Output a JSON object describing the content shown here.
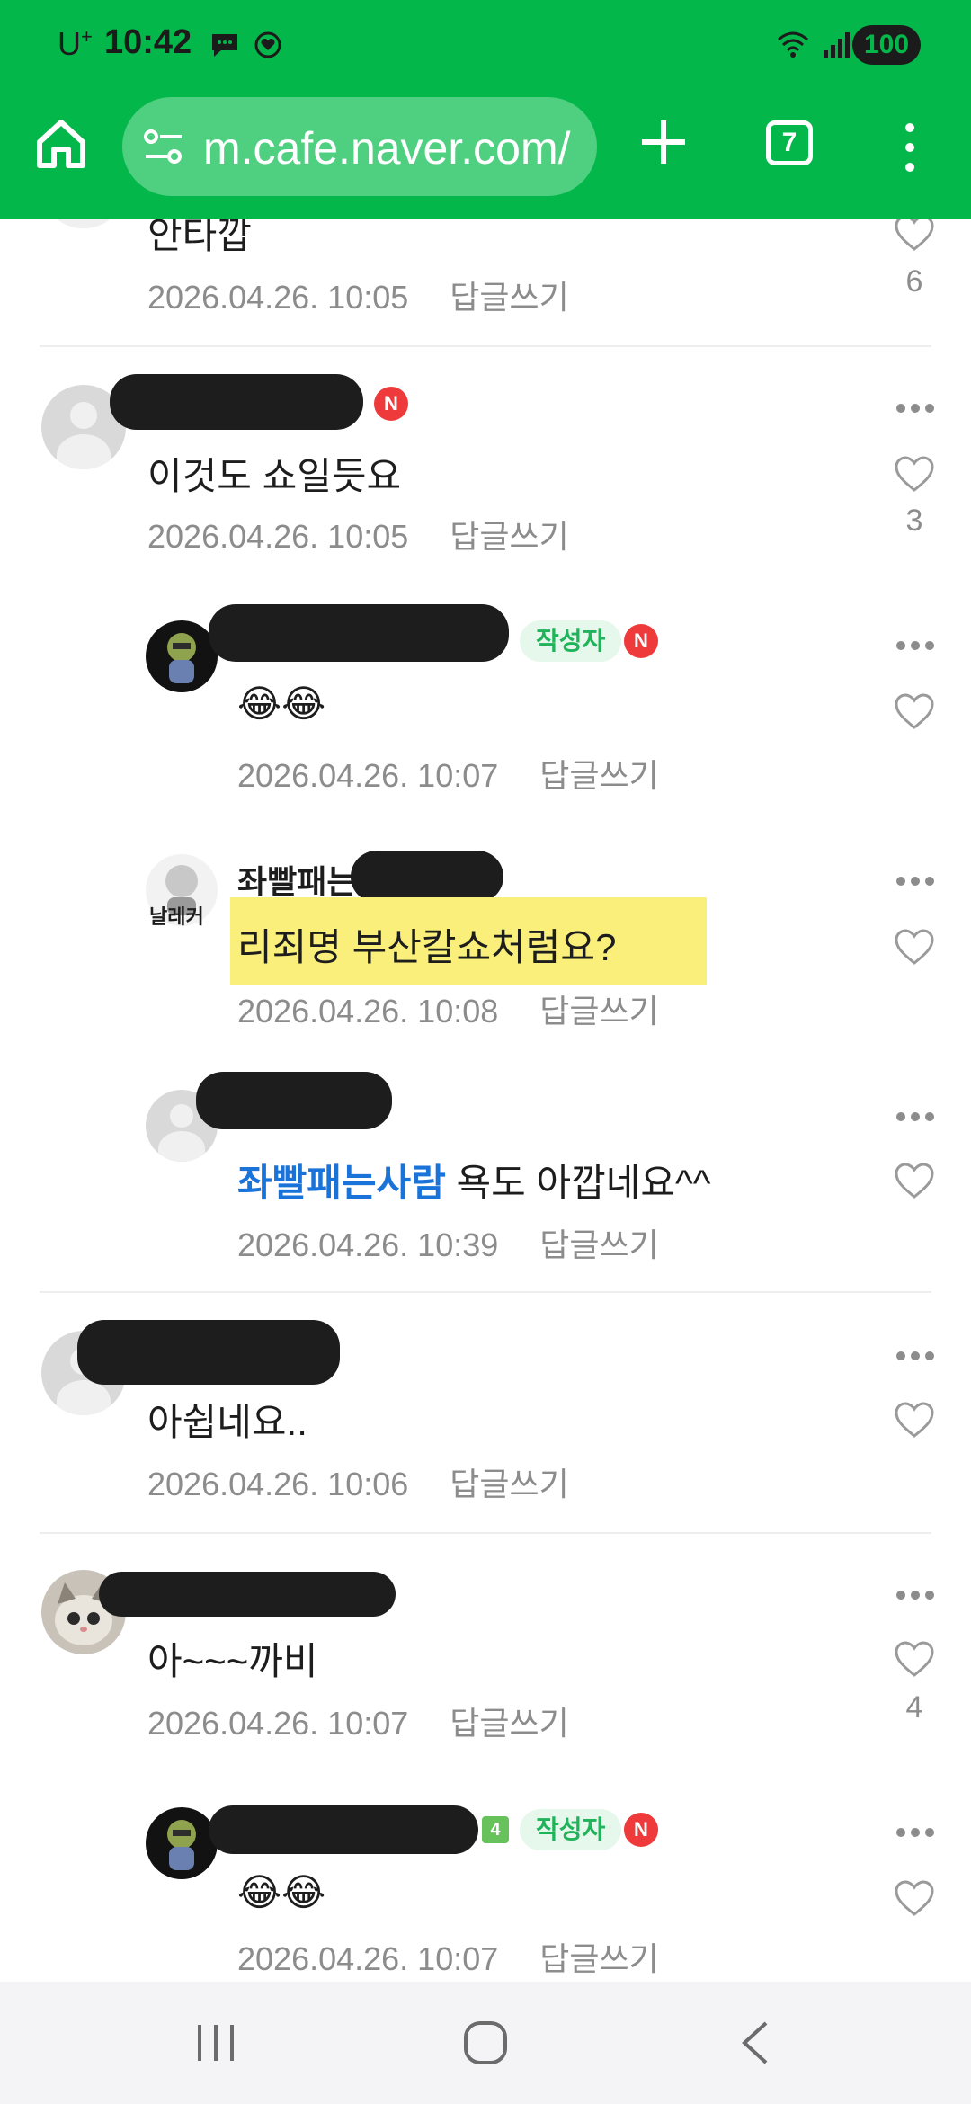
{
  "status_bar": {
    "carrier": "U",
    "carrier_sup": "+",
    "time": "10:42",
    "battery": "100",
    "icons": [
      "message-icon",
      "notification-icon",
      "wifi-icon",
      "signal-icon",
      "battery-icon"
    ]
  },
  "toolbar": {
    "url": "m.cafe.naver.com/",
    "tab_count": "7",
    "icons": [
      "home-icon",
      "site-settings-icon",
      "new-tab-icon",
      "tabs-icon",
      "more-icon"
    ]
  },
  "theme": {
    "green": "#03b74a",
    "author_badge": "#1fb35a",
    "mention": "#1a73d9",
    "new_badge": "#ee3a3a",
    "highlight": "#f9ef7a"
  },
  "comments": [
    {
      "id": "c0",
      "body": "안타깝",
      "time": "2026.04.26. 10:05",
      "reply": "답글쓰기",
      "likes": "6"
    },
    {
      "id": "c1",
      "body": "이것도 쇼일듯요",
      "time": "2026.04.26. 10:05",
      "reply": "답글쓰기",
      "likes": "3",
      "badge_new": "N"
    },
    {
      "id": "c2",
      "body": "😂😂",
      "time": "2026.04.26. 10:07",
      "reply": "답글쓰기",
      "author_badge": "작성자",
      "badge_new": "N"
    },
    {
      "id": "c3",
      "nick": "좌빨패는",
      "body": "리죄명 부산칼쇼처럼요?",
      "time": "2026.04.26. 10:08",
      "reply": "답글쓰기",
      "avatar_text": "날레커"
    },
    {
      "id": "c4",
      "mention": "좌빨패는사람",
      "body": " 욕도 아깝네요^^",
      "time": "2026.04.26. 10:39",
      "reply": "답글쓰기"
    },
    {
      "id": "c5",
      "body": "아쉽네요..",
      "time": "2026.04.26. 10:06",
      "reply": "답글쓰기"
    },
    {
      "id": "c6",
      "body": "아~~~까비",
      "time": "2026.04.26. 10:07",
      "reply": "답글쓰기",
      "likes": "4"
    },
    {
      "id": "c7",
      "body": "😂😂",
      "time": "2026.04.26. 10:07",
      "reply": "답글쓰기",
      "author_badge": "작성자",
      "badge_new": "N",
      "level": "4"
    }
  ],
  "nav": {
    "icons": [
      "recent-apps-icon",
      "home-nav-icon",
      "back-icon"
    ]
  }
}
